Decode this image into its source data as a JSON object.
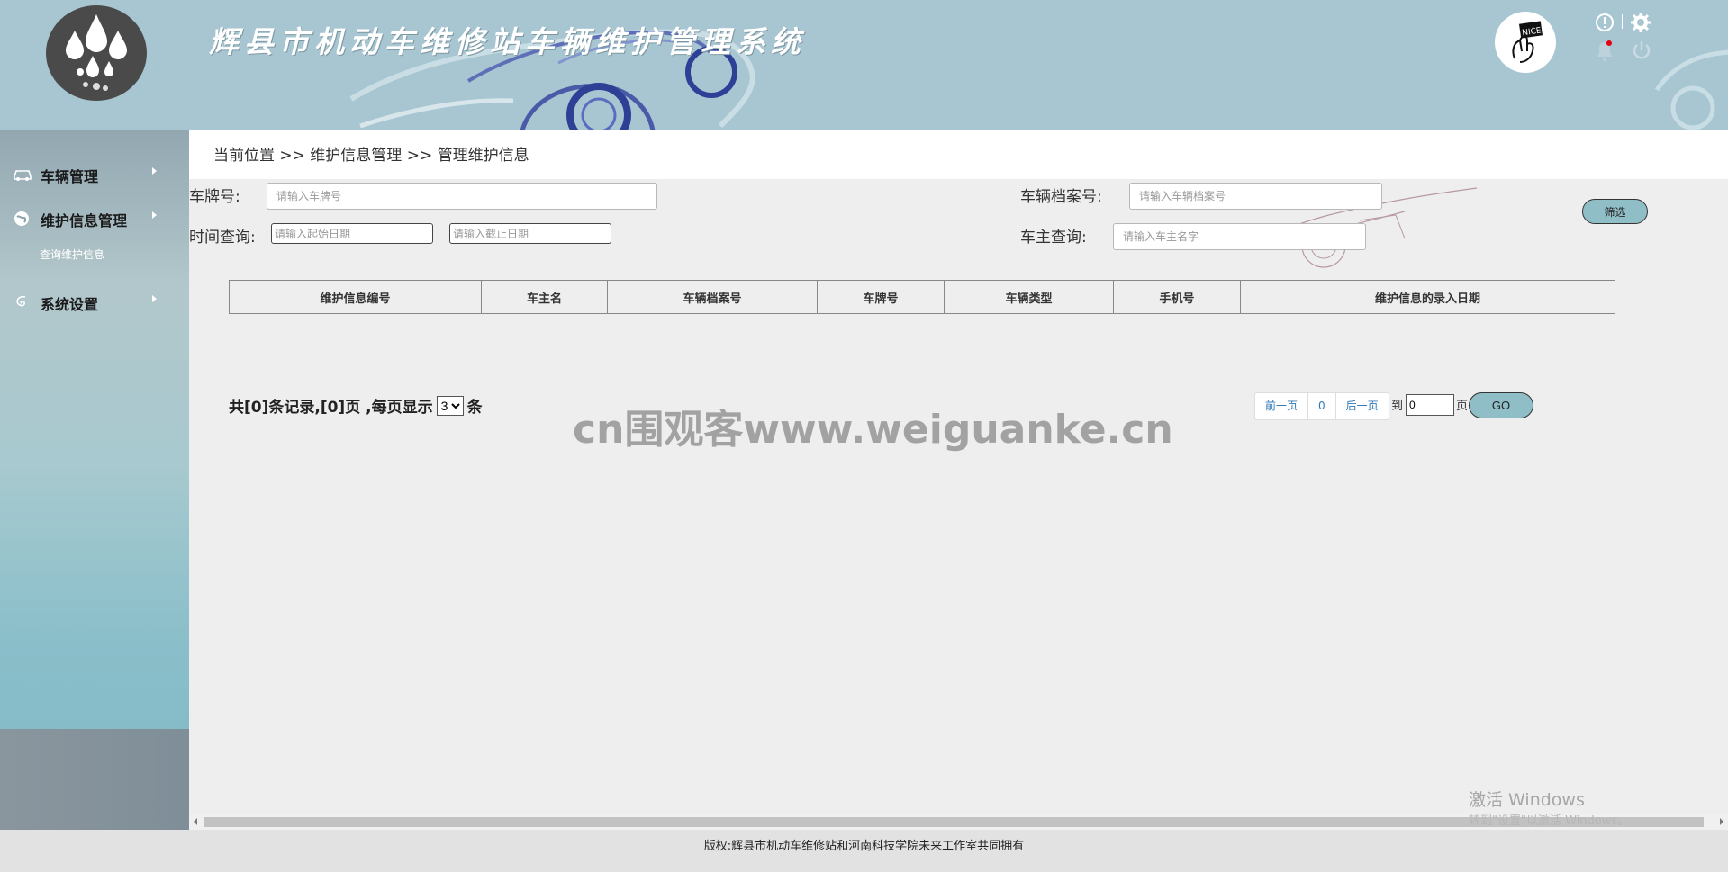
{
  "header": {
    "title": "辉县市机动车维修站车辆维护管理系统",
    "avatar_text": "NICE",
    "icons": [
      "info-icon",
      "gear-icon",
      "bell-icon",
      "power-icon"
    ]
  },
  "sidebar": {
    "items": [
      {
        "label": "车辆管理",
        "icon": "car-icon"
      },
      {
        "label": "维护信息管理",
        "icon": "globe-icon"
      },
      {
        "label": "系统设置",
        "icon": "swirl-icon"
      }
    ],
    "submenu": {
      "label": "查询维护信息"
    }
  },
  "breadcrumb": "当前位置 >> 维护信息管理 >> 管理维护信息",
  "filters": {
    "plate": {
      "label": "车牌号:",
      "placeholder": "请输入车牌号"
    },
    "archive": {
      "label": "车辆档案号:",
      "placeholder": "请输入车辆档案号"
    },
    "time": {
      "label": "时间查询:",
      "start_placeholder": "请输入起始日期",
      "end_placeholder": "请输入截止日期"
    },
    "owner": {
      "label": "车主查询:",
      "placeholder": "请输入车主名字"
    },
    "filter_button": "筛选"
  },
  "table": {
    "columns": [
      "维护信息编号",
      "车主名",
      "车辆档案号",
      "车牌号",
      "车辆类型",
      "手机号",
      "维护信息的录入日期"
    ],
    "rows": []
  },
  "pagination": {
    "summary_prefix": "共[0]条记录,[0]页 ,每页显示",
    "page_size": "3",
    "page_size_options": [
      "3"
    ],
    "summary_suffix": "条",
    "prev": "前一页",
    "current": "0",
    "next": "后一页",
    "to": "到",
    "page_input": "0",
    "page_unit": "页",
    "go": "GO"
  },
  "watermark": "cn围观客www.weiguanke.cn",
  "windows": {
    "activate_title": "激活 Windows",
    "activate_sub": "转到\"设置\"以激活 Windows。"
  },
  "footer": "版权:辉县市机动车维修站和河南科技学院未来工作室共同拥有",
  "colors": {
    "header_bg": "#a7c6d1",
    "accent_button": "#8fbec7",
    "link": "#337ab7",
    "footer_bg": "#e2e2e2"
  }
}
